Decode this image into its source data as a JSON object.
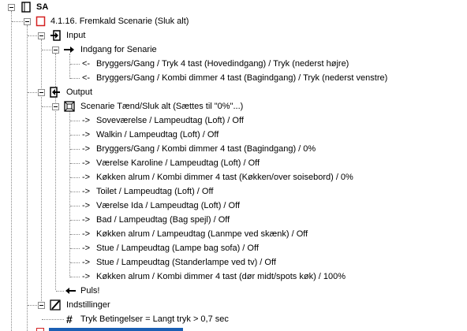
{
  "tree": {
    "root": {
      "label": "SA",
      "icon": "document-icon"
    },
    "scenario": {
      "label": "4.1.16. Fremkald Scenarie (Sluk alt)",
      "icon": "red-square-icon"
    },
    "input": {
      "label": "Input",
      "icon": "input-arrow-icon"
    },
    "indgang": {
      "label": "Indgang for Senarie",
      "icon": "arrow-right-icon"
    },
    "inputs": [
      {
        "prefix": "<-",
        "label": "Bryggers/Gang / Tryk 4 tast (Hovedindgang)  / Tryk (nederst højre)"
      },
      {
        "prefix": "<-",
        "label": "Bryggers/Gang / Kombi dimmer 4 tast (Bagindgang)  / Tryk (nederst venstre)"
      }
    ],
    "output": {
      "label": "Output",
      "icon": "output-arrow-icon"
    },
    "scene_action": {
      "label": "Scenarie Tænd/Sluk alt (Sættes til \"0%\"...)",
      "icon": "scene-icon"
    },
    "outputs": [
      {
        "prefix": "->",
        "label": "Soveværelse / Lampeudtag (Loft)  / Off"
      },
      {
        "prefix": "->",
        "label": "Walkin / Lampeudtag (Loft)  / Off"
      },
      {
        "prefix": "->",
        "label": "Bryggers/Gang / Kombi dimmer 4 tast (Bagindgang)  / 0%"
      },
      {
        "prefix": "->",
        "label": "Værelse Karoline / Lampeudtag (Loft)  / Off"
      },
      {
        "prefix": "->",
        "label": "Køkken alrum / Kombi dimmer 4 tast (Køkken/over soisebord)  / 0%"
      },
      {
        "prefix": "->",
        "label": "Toilet / Lampeudtag (Loft)  / Off"
      },
      {
        "prefix": "->",
        "label": "Værelse Ida / Lampeudtag (Loft)  / Off"
      },
      {
        "prefix": "->",
        "label": "Bad / Lampeudtag (Bag spejl)  / Off"
      },
      {
        "prefix": "->",
        "label": "Køkken alrum / Lampeudtag (Lanmpe ved skænk)  / Off"
      },
      {
        "prefix": "->",
        "label": "Stue / Lampeudtag (Lampe bag sofa)  / Off"
      },
      {
        "prefix": "->",
        "label": "Stue / Lampeudtag (Standerlampe ved tv)  / Off"
      },
      {
        "prefix": "->",
        "label": "Køkken alrum / Kombi dimmer 4 tast (dør midt/spots køk)  / 100%"
      }
    ],
    "puls": {
      "label": "Puls!",
      "icon": "arrow-left-icon"
    },
    "indstillinger": {
      "label": "Indstillinger",
      "icon": "edit-icon"
    },
    "setting": {
      "label": "Tryk Betingelser = Langt tryk > 0,7 sec",
      "icon": "hash-icon"
    }
  },
  "colors": {
    "accent_red": "#d42020",
    "selection": "#1a5fb4"
  }
}
